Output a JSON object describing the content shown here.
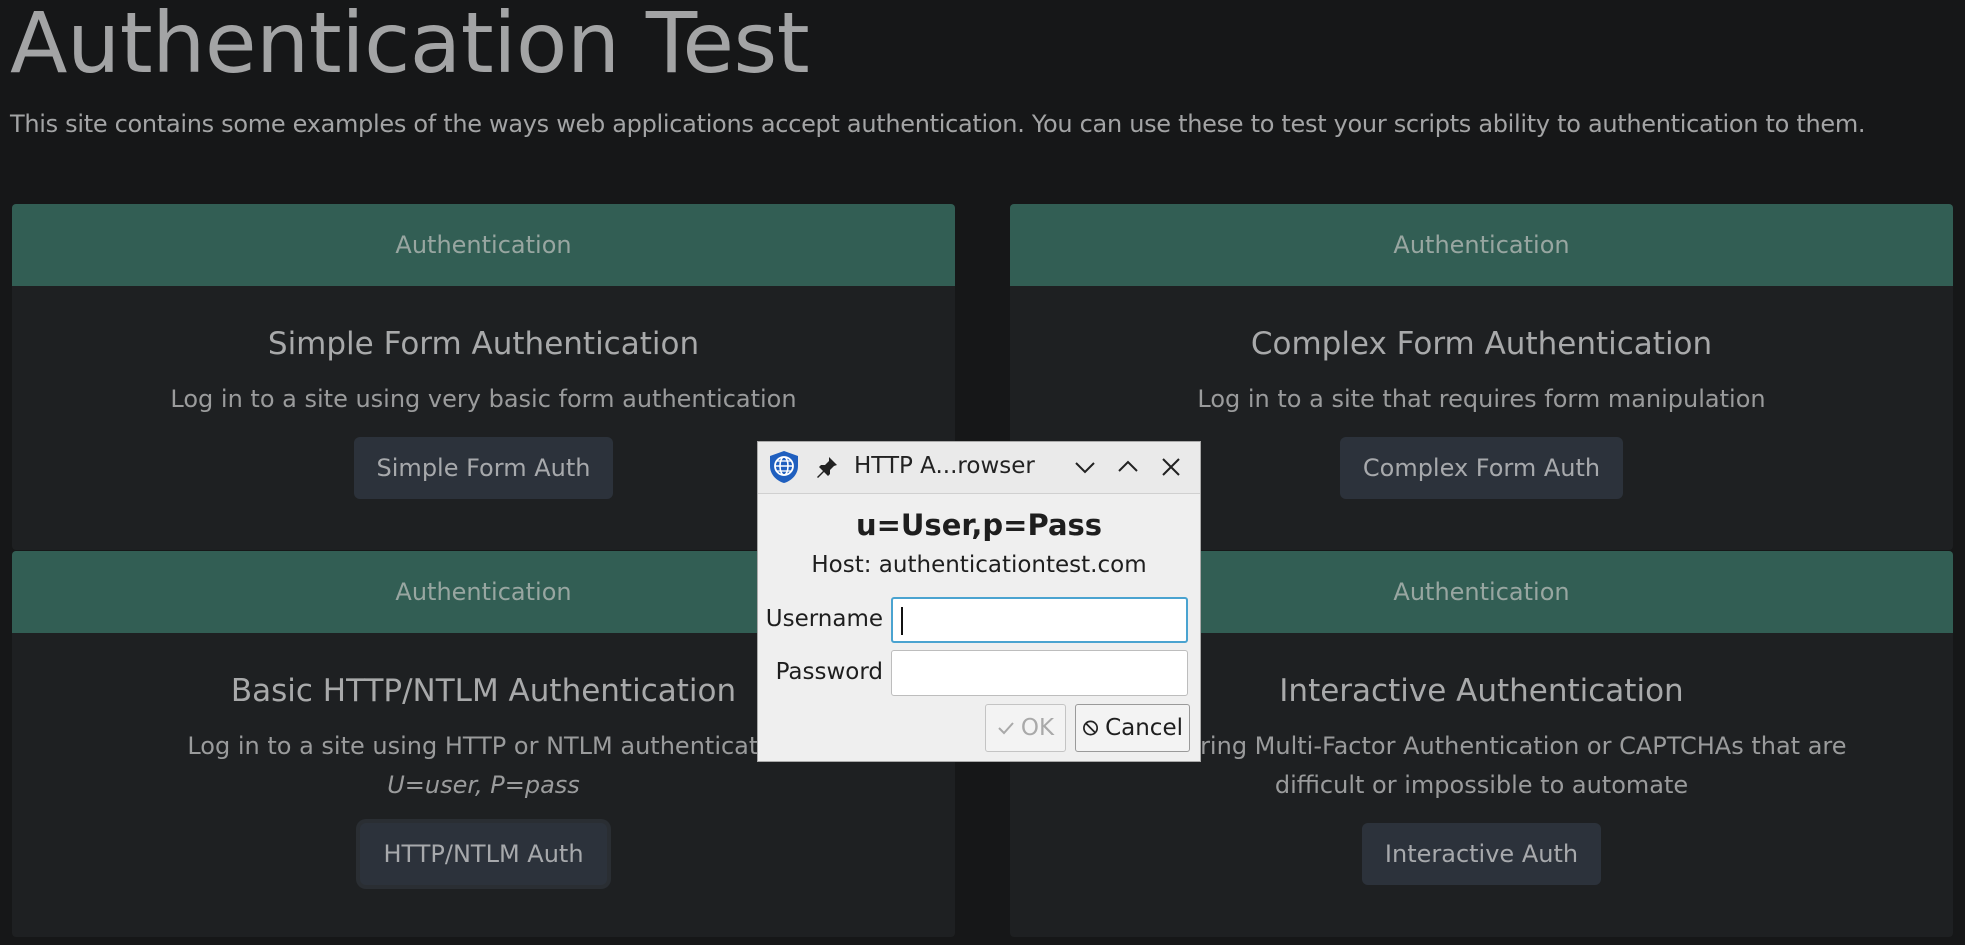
{
  "page": {
    "title": "Authentication Test",
    "intro": "This site contains some examples of the ways web applications accept authentication. You can use these to test your scripts ability to authentication to them."
  },
  "cards": [
    {
      "header": "Authentication",
      "title": "Simple Form Authentication",
      "text": "Log in to a site using very basic form authentication",
      "button": "Simple Form Auth"
    },
    {
      "header": "Authentication",
      "title": "Complex Form Authentication",
      "text": "Log in to a site that requires form manipulation",
      "button": "Complex Form Auth"
    },
    {
      "header": "Authentication",
      "title": "Basic HTTP/NTLM Authentication",
      "text": "Log in to a site using HTTP or NTLM authenticatio",
      "note": "U=user, P=pass",
      "button": "HTTP/NTLM Auth"
    },
    {
      "header": "Authentication",
      "title": "Interactive Authentication",
      "text_line1": "e requiring Multi-Factor Authentication or CAPTCHAs that are",
      "text_line2": "difficult or impossible to automate",
      "button": "Interactive Auth"
    }
  ],
  "dialog": {
    "window_title": "HTTP A...rowser",
    "heading": "u=User,p=Pass",
    "host": "Host: authenticationtest.com",
    "username_label": "Username",
    "username_value": "",
    "password_label": "Password",
    "password_value": "",
    "ok_label": "OK",
    "cancel_label": "Cancel"
  },
  "colors": {
    "page_bg": "#161718",
    "card_bg": "#1e2022",
    "card_header": "#325e54",
    "button_bg": "#2c323b",
    "dialog_bg": "#efefef",
    "focus_border": "#4aa3d0"
  }
}
